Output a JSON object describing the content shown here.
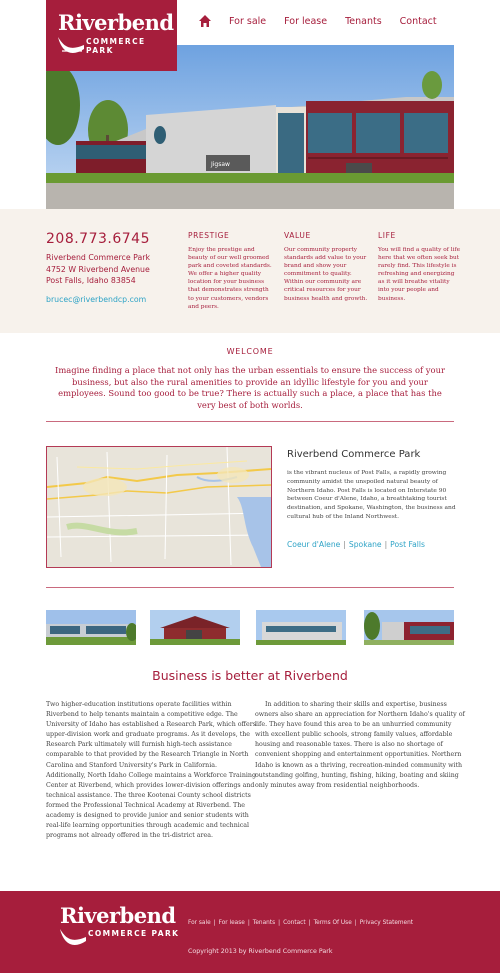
{
  "brand": {
    "name": "Riverbend",
    "sub": "COMMERCE PARK",
    "color": "#a61e3c"
  },
  "nav": {
    "home_icon": "home-icon",
    "items": [
      "For sale",
      "For lease",
      "Tenants",
      "Contact"
    ]
  },
  "contact": {
    "phone": "208.773.6745",
    "address_line1": "Riverbend Commerce Park",
    "address_line2": "4752 W Riverbend Avenue",
    "address_line3": "Post Falls, Idaho 83854",
    "email": "brucec@riverbendcp.com"
  },
  "columns": [
    {
      "title": "PRESTIGE",
      "text": "Enjoy the prestige and beauty of our well groomed park and coveted standards. We offer a higher quality location for your business that demonstrates strength to your customers, vendors and peers."
    },
    {
      "title": "VALUE",
      "text": "Our community property standards add value to your brand and show your commitment to quality. Within our community are critical resources for your business health and growth."
    },
    {
      "title": "LIFE",
      "text": "You will find a quality of life here that we often seek but rarely find.  This lifestyle is refreshing and energizing as it will breathe vitality into your people and business."
    }
  ],
  "welcome": {
    "title": "WELCOME",
    "text": "Imagine finding a place that not only has the urban essentials to ensure the success of your business, but also the rural amenities to provide an idyllic lifestyle for you and your employees. Sound too good to be true? There is actually such a place, a place that has the very best of both worlds."
  },
  "park": {
    "title": "Riverbend Commerce Park",
    "text": "is the vibrant nucleus of Post Falls, a rapidly growing community amidst the unspoiled natural beauty of Northern Idaho. Post Falls is located on Interstate 90 between Coeur d'Alene, Idaho, a breathtaking tourist destination, and Spokane, Washington, the business and cultural hub of the Inland Northwest.",
    "cities": [
      "Coeur d'Alene",
      "Spokane",
      "Post Falls"
    ]
  },
  "business": {
    "title": "Business is better at Riverbend",
    "col1": "Two higher-education institutions operate facilities within Riverbend to help tenants maintain a competitive edge. The University of Idaho has established a Research Park, which offers upper-division work and graduate programs. As it develops, the Research Park ultimately will furnish high-tech assistance comparable to that provided by the Research Triangle in North Carolina and Stanford University's Park in California. Additionally, North Idaho College maintains a Workforce Training Center at Riverbend, which provides lower-division offerings and technical assistance. The three Kootenai County school districts formed the Professional Technical Academy at Riverbend. The academy is designed to provide junior and senior students with real-life learning opportunities through academic and technical programs not already offered in the tri-district area.",
    "col2": "In addition to sharing their skills and expertise, business owners also share an appreciation for Northern Idaho's quality of life. They have found this area to be an unhurried community with excellent public schools, strong family values, affordable housing and reasonable taxes. There is also no shortage of convenient shopping and entertainment opportunities. Northern Idaho is known as a thriving, recreation-minded community with outstanding golfing, hunting, fishing, hiking, boating and skiing only minutes away from residential neighborhoods."
  },
  "footer": {
    "links": [
      "For sale",
      "For lease",
      "Tenants",
      "Contact",
      "Terms Of Use",
      "Privacy Statement"
    ],
    "copyright": "Copyright 2013 by Riverbend Commerce Park"
  }
}
